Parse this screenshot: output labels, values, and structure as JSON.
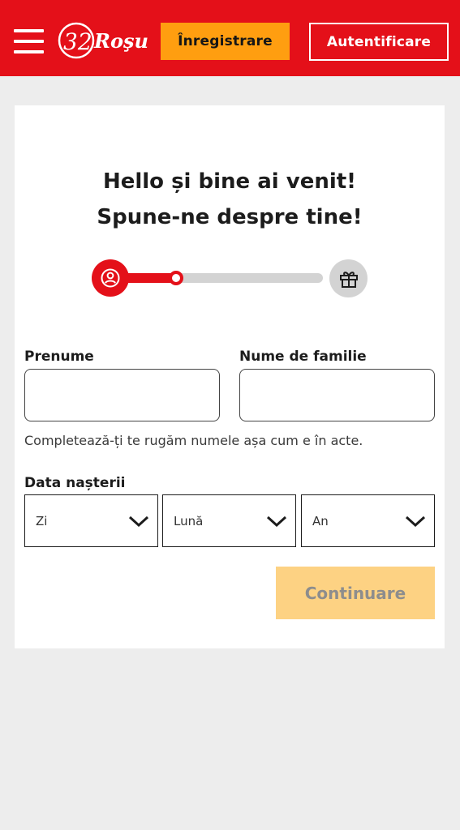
{
  "header": {
    "logo_text": "32Roșu",
    "register_label": "Înregistrare",
    "login_label": "Autentificare",
    "menu_icon": "hamburger-icon",
    "colors": {
      "brand_red": "#e41019",
      "accent_orange": "#ff9e10"
    }
  },
  "card": {
    "title_line1": "Hello și bine ai venit!",
    "title_line2": "Spune-ne despre tine!",
    "progress": {
      "current_step": 1,
      "start_icon": "user-icon",
      "end_icon": "gift-icon"
    },
    "first_name": {
      "label": "Prenume",
      "value": ""
    },
    "last_name": {
      "label": "Nume de familie",
      "value": ""
    },
    "hint": "Completează-ți te rugăm numele așa cum e în acte.",
    "birthdate": {
      "label": "Data nașterii",
      "day": "Zi",
      "month": "Lună",
      "year": "An"
    },
    "continue_label": "Continuare"
  }
}
